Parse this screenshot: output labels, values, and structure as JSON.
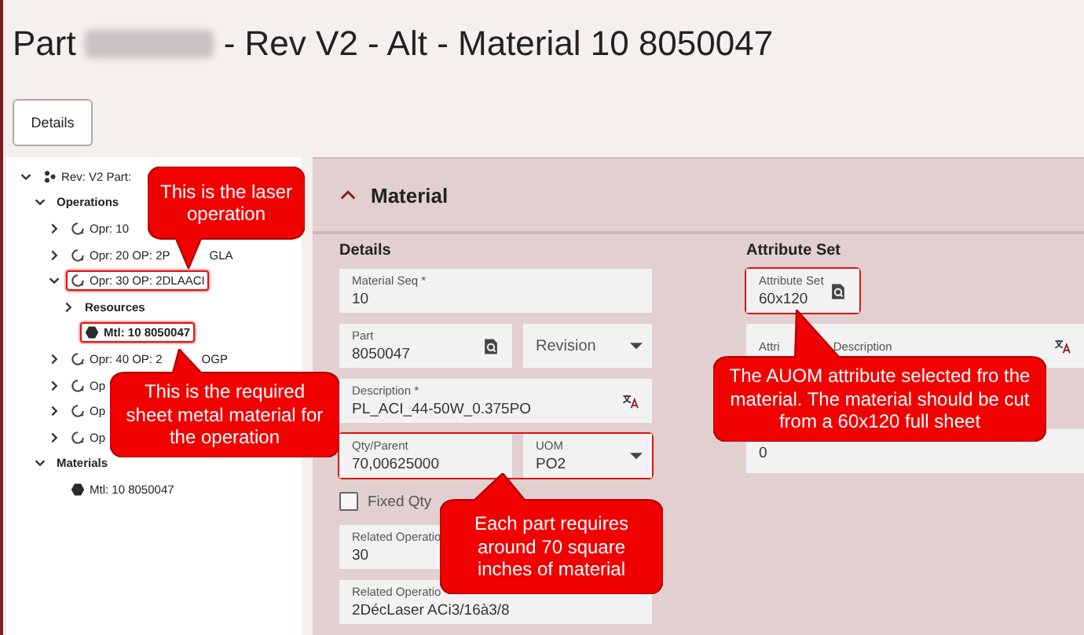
{
  "title": {
    "prefix": "Part",
    "redacted": true,
    "suffix": "- Rev V2 - Alt - Material 10 8050047"
  },
  "details_button": "Details",
  "tree": [
    {
      "label": "Rev: V2 Part:",
      "kind": "revision",
      "expanded": true,
      "selected": false,
      "highlighted": false,
      "children": [
        {
          "label": "Operations",
          "kind": "group",
          "expanded": true,
          "selected": false,
          "highlighted": false,
          "children": [
            {
              "label": "Opr: 10",
              "kind": "operation",
              "expanded": false,
              "selected": false,
              "highlighted": false
            },
            {
              "label": "Opr: 20 OP: 2P",
              "label_tail": "GLA",
              "kind": "operation",
              "expanded": false,
              "selected": false,
              "highlighted": false
            },
            {
              "label": "Opr: 30 OP: 2DLAACI",
              "kind": "operation",
              "expanded": true,
              "selected": false,
              "highlighted": true,
              "children": [
                {
                  "label": "Resources",
                  "kind": "group",
                  "expanded": false,
                  "selected": false,
                  "highlighted": false
                },
                {
                  "label": "Mtl: 10 8050047",
                  "kind": "material",
                  "selected": true,
                  "highlighted": true
                }
              ]
            },
            {
              "label": "Opr: 40 OP: 2",
              "label_tail": "OGP",
              "kind": "operation",
              "expanded": false,
              "selected": false,
              "highlighted": false
            },
            {
              "label": "Op",
              "kind": "operation",
              "expanded": false,
              "selected": false,
              "highlighted": false
            },
            {
              "label": "Op",
              "kind": "operation",
              "expanded": false,
              "selected": false,
              "highlighted": false
            },
            {
              "label": "Op",
              "kind": "operation",
              "expanded": false,
              "selected": false,
              "highlighted": false
            }
          ]
        },
        {
          "label": "Materials",
          "kind": "group",
          "expanded": true,
          "selected": false,
          "highlighted": false,
          "children": [
            {
              "label": "Mtl: 10 8050047",
              "kind": "material",
              "selected": false,
              "highlighted": false
            }
          ]
        }
      ]
    }
  ],
  "panel": {
    "title": "Material",
    "expanded": true,
    "columns": [
      {
        "heading": "Details",
        "rows": [
          {
            "highlighted": false,
            "fields": [
              {
                "kind": "text",
                "label": "Material Seq *",
                "value": "10"
              }
            ]
          },
          {
            "highlighted": false,
            "fields": [
              {
                "kind": "lookup",
                "label": "Part",
                "value": "8050047"
              },
              {
                "kind": "dropdown",
                "label": "Revision"
              }
            ]
          },
          {
            "highlighted": false,
            "fields": [
              {
                "kind": "translate",
                "label": "Description *",
                "value": "PL_ACI_44-50W_0.375PO"
              }
            ]
          },
          {
            "highlighted": true,
            "fields": [
              {
                "kind": "text",
                "label": "Qty/Parent",
                "value": "70,00625000"
              },
              {
                "kind": "dropdown",
                "label": "UOM",
                "value": "PO2"
              }
            ]
          },
          {
            "highlighted": false,
            "fields": [
              {
                "kind": "checkbox",
                "label": "Fixed Qty",
                "checked": false
              }
            ]
          },
          {
            "highlighted": false,
            "fields": [
              {
                "kind": "text",
                "label": "Related Operatio",
                "value": "30"
              }
            ]
          },
          {
            "highlighted": false,
            "fields": [
              {
                "kind": "text",
                "label": "Related Operatio",
                "value": "2DécLaser ACi3/16à3/8"
              }
            ]
          }
        ]
      },
      {
        "heading": "Attribute Set",
        "rows": [
          {
            "highlighted": true,
            "fields": [
              {
                "kind": "lookup",
                "label": "Attribute Set",
                "value": "60x120"
              }
            ]
          },
          {
            "highlighted": false,
            "fields": [
              {
                "kind": "translate",
                "label": "Attri",
                "label_tail": "Description"
              }
            ]
          },
          {
            "highlighted": false,
            "fields": [
              {
                "kind": "text",
                "value": "0"
              }
            ]
          }
        ]
      }
    ]
  },
  "annotations": [
    {
      "text": "This is the laser operation"
    },
    {
      "text": "This is the required sheet metal material for the operation"
    },
    {
      "text": "Each part requires around 70 square inches of material"
    },
    {
      "text": "The AUOM attribute selected fro the material. The material should be cut from a 60x120 full sheet"
    }
  ]
}
